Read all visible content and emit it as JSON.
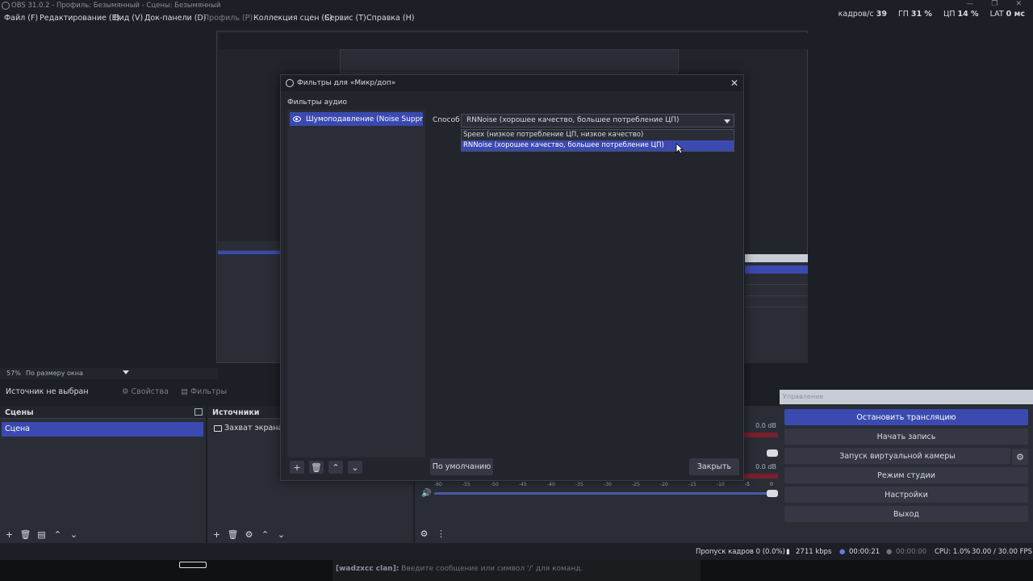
{
  "window": {
    "title": "OBS 31.0.2 - Профиль: Безымянный - Сцены: Безымянный",
    "controls": [
      "—",
      "❐",
      "✕"
    ]
  },
  "menu": {
    "items": [
      {
        "label": "Файл (F)",
        "disabled": false
      },
      {
        "label": "Редактирование (E)",
        "disabled": false
      },
      {
        "label": "Вид (V)",
        "disabled": false
      },
      {
        "label": "Док-панели (D)",
        "disabled": false
      },
      {
        "label": "Профиль (P)",
        "disabled": true
      },
      {
        "label": "Коллекция сцен (S)",
        "disabled": false
      },
      {
        "label": "Сервис (T)",
        "disabled": false
      },
      {
        "label": "Справка (H)",
        "disabled": false
      }
    ]
  },
  "stats": {
    "fps_label": "кадров/с",
    "fps_value": "39",
    "gpu_label": "ГП",
    "gpu_value": "31 %",
    "cpu_label": "ЦП",
    "cpu_value": "14 %",
    "lat_label": "LAT",
    "lat_value": "0 мс"
  },
  "preview": {
    "zoom": "57%",
    "zoom_mode": "По размеру окна"
  },
  "context": {
    "no_source": "Источник не выбран",
    "properties": "Свойства",
    "filters": "Фильтры"
  },
  "scenes": {
    "title": "Сцены",
    "items": [
      "Сцена"
    ]
  },
  "sources": {
    "title": "Источники",
    "items": [
      "Захват экрана"
    ]
  },
  "mixer": {
    "db1": "0.0 dB",
    "db2": "0.0 dB",
    "scale": [
      "-60",
      "-55",
      "-50",
      "-45",
      "-40",
      "-35",
      "-30",
      "-25",
      "-20",
      "-15",
      "-10",
      "-5",
      "0"
    ]
  },
  "controls": {
    "title": "Управление",
    "stop_stream": "Остановить трансляцию",
    "start_record": "Начать запись",
    "virtual_cam": "Запуск виртуальной камеры",
    "studio_mode": "Режим студии",
    "settings": "Настройки",
    "exit": "Выход"
  },
  "status": {
    "dropped": "Пропуск кадров 0 (0.0%)",
    "bitrate": "2711 kbps",
    "stream_time": "00:00:21",
    "record_time": "00:00:00",
    "cpu": "CPU: 1.0%",
    "fps": "30.00 / 30.00 FPS"
  },
  "chat": {
    "user": "[wadzxcc clan]:",
    "text": "Введите сообщение или символ '/' для команд."
  },
  "filters_dialog": {
    "title": "Фильтры для «Микр/доп»",
    "section": "Фильтры аудио",
    "filter_name": "Шумоподавление (Noise Suppres",
    "method_label": "Способ",
    "method_value": "RNNoise (хорошее качество, большее потребление ЦП)",
    "options": [
      "Speex (низкое потребление ЦП, низкое качество)",
      "RNNoise (хорошее качество, большее потребление ЦП)"
    ],
    "defaults_button": "По умолчанию",
    "close_button": "Закрыть"
  },
  "colors": {
    "accent": "#3b4ab0",
    "background": "#1d1f26",
    "panel": "#2a2d36",
    "meter_red": "#7a1f2d"
  }
}
